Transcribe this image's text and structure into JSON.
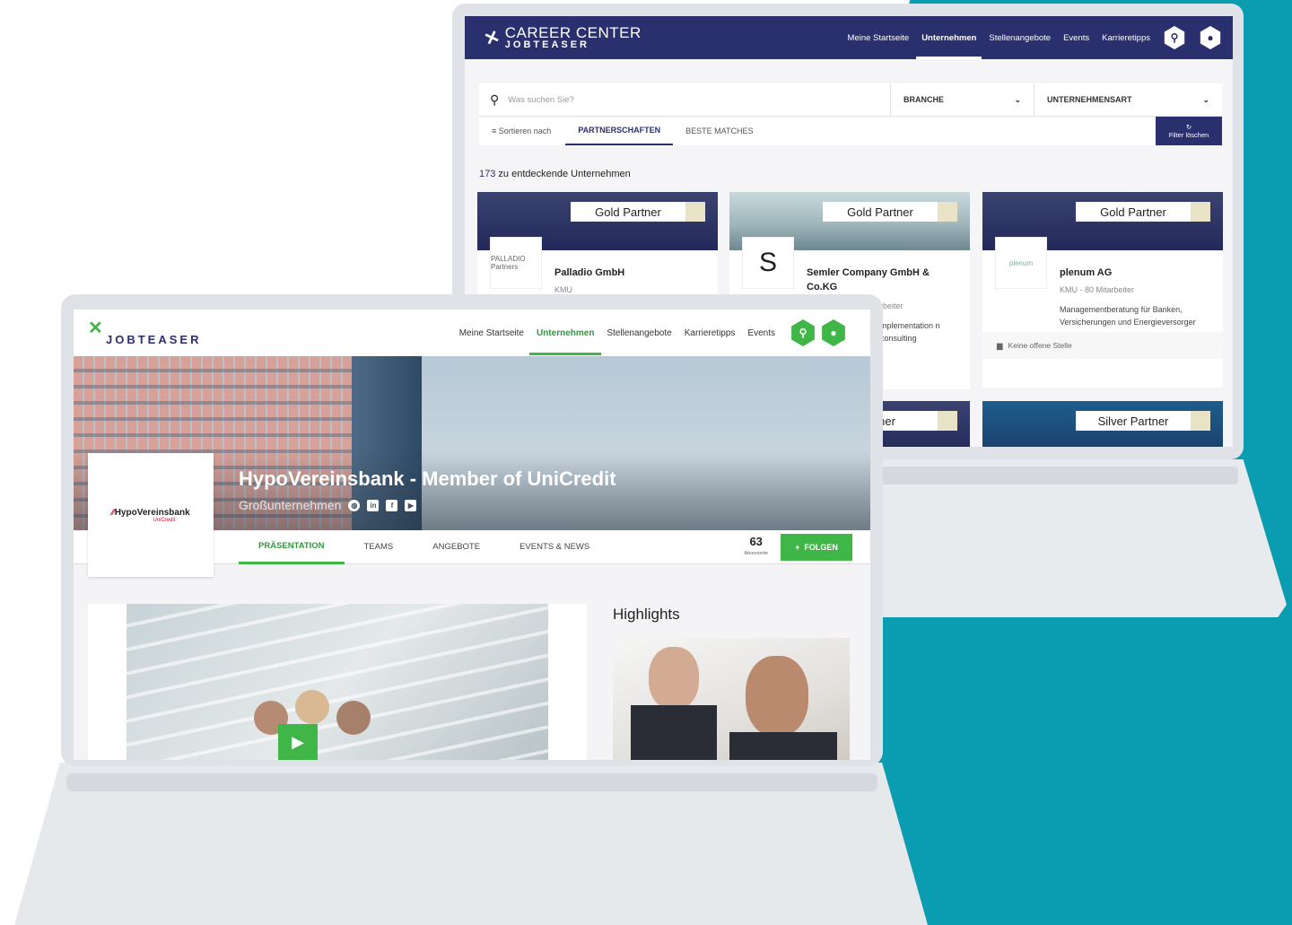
{
  "back": {
    "logo": {
      "line1": "CAREER CENTER",
      "line2": "JOBTEASER"
    },
    "nav": [
      "Meine Startseite",
      "Unternehmen",
      "Stellenangebote",
      "Events",
      "Karrieretipps"
    ],
    "search_placeholder": "Was suchen Sie?",
    "filters": [
      "BRANCHE",
      "UNTERNEHMENSART"
    ],
    "sort_label": "Sortieren nach",
    "sort_tabs": [
      "PARTNERSCHAFTEN",
      "BESTE MATCHES"
    ],
    "clear_filter": "Filter löschen",
    "count": "173",
    "count_label": " zu entdeckende Unternehmen",
    "cards": [
      {
        "badge": "Gold Partner",
        "logo": "PALLADIO Partners",
        "name": "Palladio GmbH",
        "sub": "KMU",
        "desc": ""
      },
      {
        "badge": "Gold Partner",
        "logo": "S",
        "name": "Semler Company GmbH & Co.KG",
        "sub": "rbeiter",
        "desc": "mplementation n consulting"
      },
      {
        "badge": "Gold Partner",
        "logo": "plenum",
        "name": "plenum AG",
        "sub": "KMU - 80 Mitarbeiter",
        "desc": "Managementberatung für Banken, Versicherungen und Energieversorger",
        "foot": "Keine offene Stelle"
      }
    ],
    "row2": [
      {
        "badge": "artner"
      },
      {
        "badge": "Silver Partner"
      }
    ]
  },
  "front": {
    "logo": "JOBTEASER",
    "nav": [
      "Meine Startseite",
      "Unternehmen",
      "Stellenangebote",
      "Karrieretipps",
      "Events"
    ],
    "company": "HypoVereinsbank - Member of UniCredit",
    "size": "Großunternehmen",
    "logo_text": {
      "a": "HypoVereinsbank",
      "b": "UniCredit"
    },
    "tabs": [
      "PRÄSENTATION",
      "TEAMS",
      "ANGEBOTE",
      "EVENTS & NEWS"
    ],
    "followers": "63",
    "followers_label": "Abonnierte",
    "follow": "FOLGEN",
    "highlights": "Highlights"
  },
  "colors": {
    "navy": "#2a2f6e",
    "green": "#41b648",
    "teal": "#0a9cb0"
  }
}
